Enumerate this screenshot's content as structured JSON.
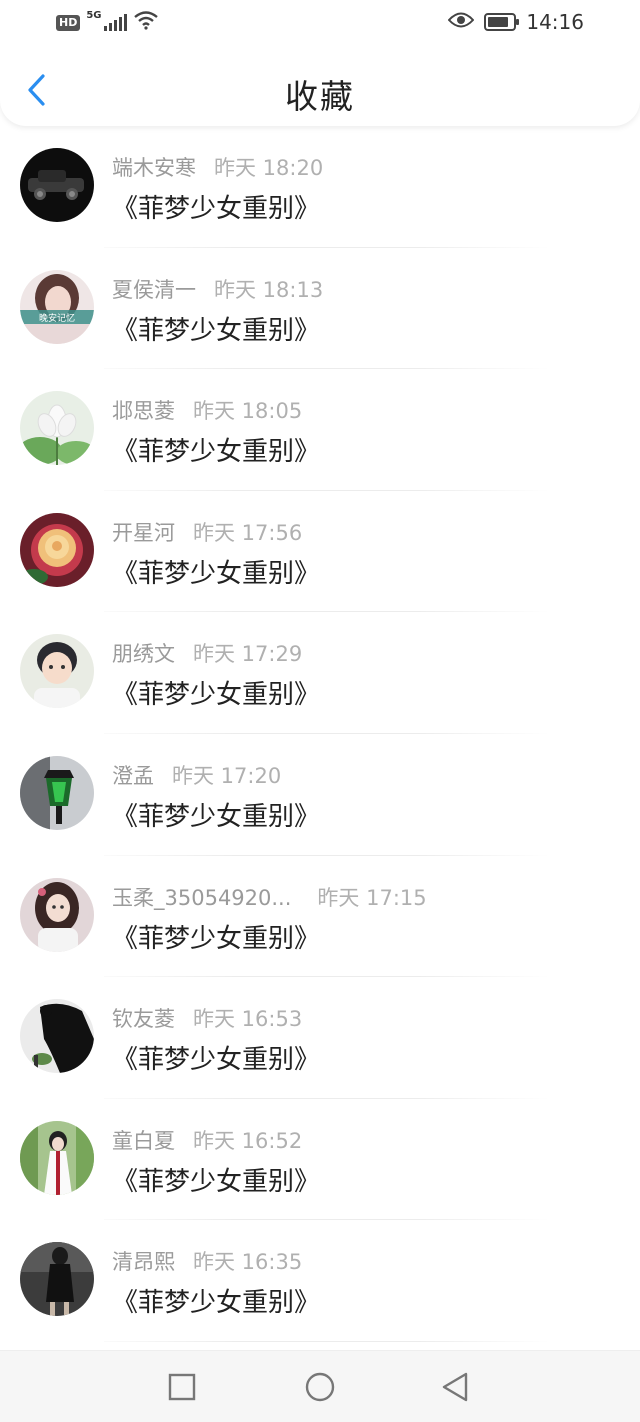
{
  "status_bar": {
    "hd": "HD",
    "network": "5G",
    "time": "14:16",
    "battery_level": 0.8
  },
  "header": {
    "title": "收藏",
    "back_icon": "chevron-left-icon",
    "accent": "#2a8ef0"
  },
  "items": [
    {
      "name": "端木安寒",
      "time": "昨天 18:20",
      "title": "《菲梦少女重别》"
    },
    {
      "name": "夏侯清一",
      "time": "昨天 18:13",
      "title": "《菲梦少女重别》"
    },
    {
      "name": "邶思菱",
      "time": "昨天 18:05",
      "title": "《菲梦少女重别》"
    },
    {
      "name": "开星河",
      "time": "昨天 17:56",
      "title": "《菲梦少女重别》"
    },
    {
      "name": "朋绣文",
      "time": "昨天 17:29",
      "title": "《菲梦少女重别》"
    },
    {
      "name": "澄孟",
      "time": "昨天 17:20",
      "title": "《菲梦少女重别》"
    },
    {
      "name": "玉柔_35054920...",
      "time": "昨天 17:15",
      "title": "《菲梦少女重别》"
    },
    {
      "name": "钦友菱",
      "time": "昨天 16:53",
      "title": "《菲梦少女重别》"
    },
    {
      "name": "童白夏",
      "time": "昨天 16:52",
      "title": "《菲梦少女重别》"
    },
    {
      "name": "清昂熙",
      "time": "昨天 16:35",
      "title": "《菲梦少女重别》"
    }
  ],
  "avatar_text": "晚安记忆",
  "bottom_nav": {
    "icons": [
      "square-icon",
      "circle-icon",
      "triangle-back-icon"
    ]
  }
}
